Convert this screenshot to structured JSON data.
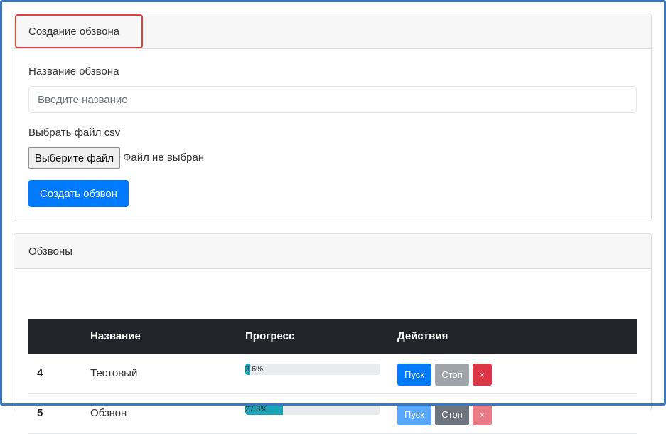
{
  "create_card": {
    "title": "Создание обзвона",
    "name_label": "Название обзвона",
    "name_placeholder": "Введите название",
    "file_label": "Выбрать файл csv",
    "file_button": "Выберите файл",
    "file_status": "Файл не выбран",
    "submit_label": "Создать обзвон"
  },
  "list_card": {
    "title": "Обзвоны",
    "columns": [
      "",
      "Название",
      "Прогресс",
      "Действия"
    ],
    "rows": [
      {
        "id": "4",
        "name": "Тестовый",
        "progress": 3.6,
        "progress_label": "3.6%",
        "actions": [
          "Пуск",
          "Стоп",
          "×"
        ],
        "disabled": [
          "stop"
        ]
      },
      {
        "id": "5",
        "name": "Обзвон",
        "progress": 27.8,
        "progress_label": "27.8%",
        "actions": [
          "Пуск",
          "Стоп",
          "×"
        ],
        "disabled": [
          "start",
          "delete"
        ]
      }
    ]
  },
  "colors": {
    "primary": "#007bff",
    "secondary": "#6c757d",
    "danger": "#dc3545",
    "info": "#17a2b8",
    "table_header": "#212529",
    "highlight": "#e0433b"
  }
}
